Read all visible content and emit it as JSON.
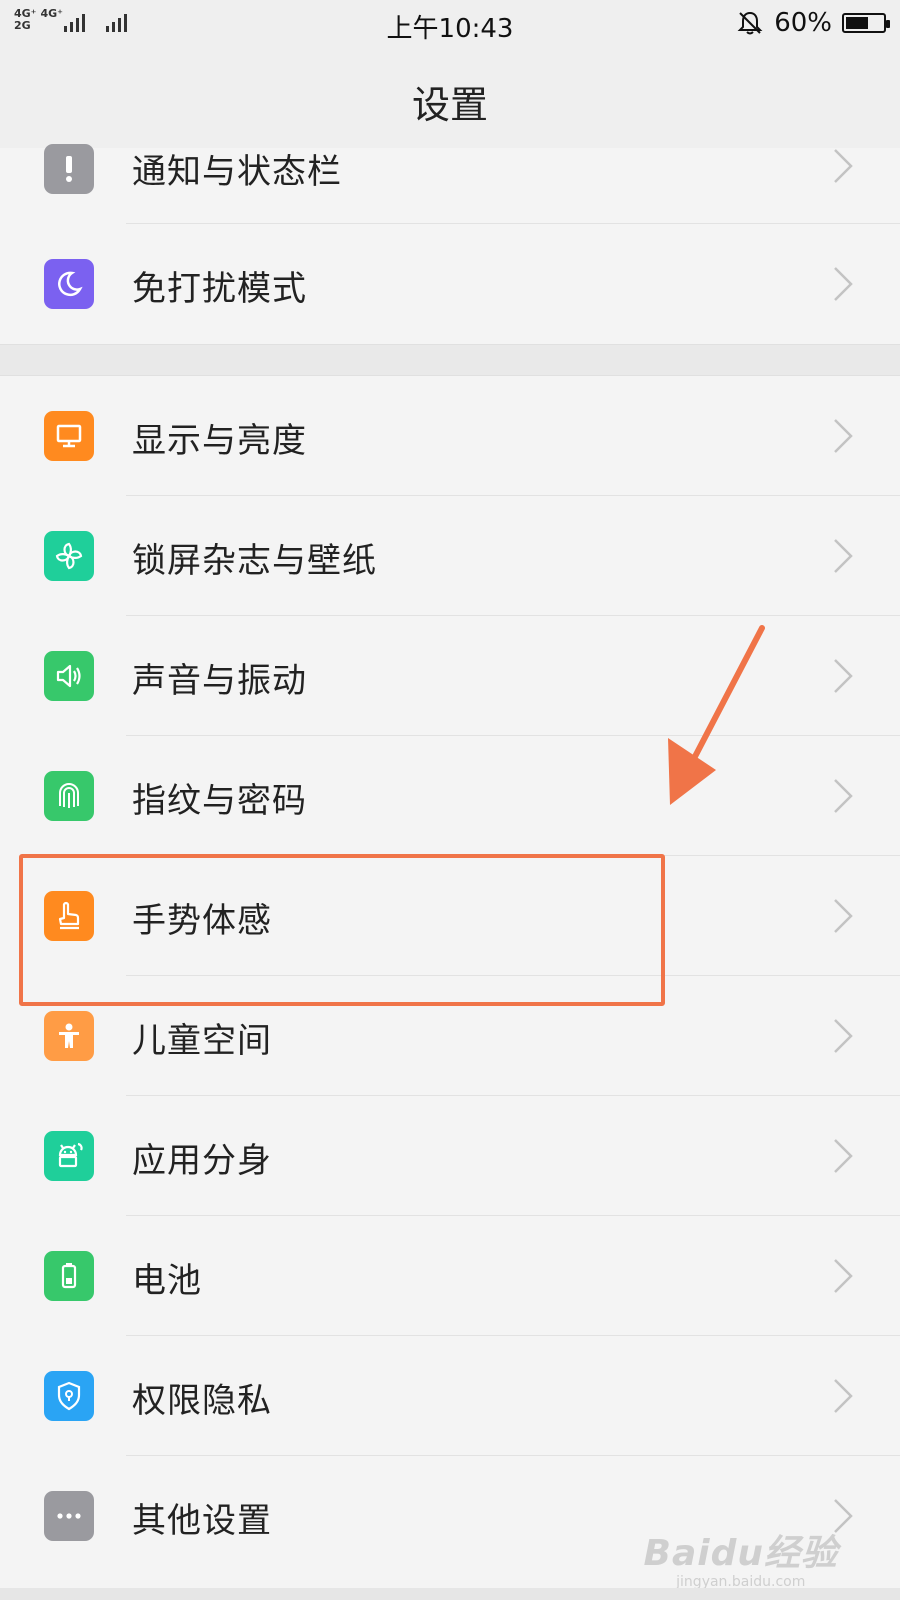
{
  "status_bar": {
    "network_top": [
      "4G⁺",
      "4G⁺"
    ],
    "network_bottom": [
      "2G"
    ],
    "network_label_2g": "2G",
    "time": "上午10:43",
    "battery_percent": "60%",
    "battery_level": 0.6
  },
  "header": {
    "title": "设置"
  },
  "groups": [
    {
      "items": [
        {
          "label": "通知与状态栏",
          "icon": "notification-icon",
          "color": "#9a9a9f"
        },
        {
          "label": "免打扰模式",
          "icon": "moon-icon",
          "color": "#7b61f0"
        }
      ]
    },
    {
      "items": [
        {
          "label": "显示与亮度",
          "icon": "display-icon",
          "color": "#ff8a1f"
        },
        {
          "label": "锁屏杂志与壁纸",
          "icon": "pinwheel-icon",
          "color": "#1fcf9a"
        },
        {
          "label": "声音与振动",
          "icon": "speaker-icon",
          "color": "#37c86b"
        },
        {
          "label": "指纹与密码",
          "icon": "fingerprint-icon",
          "color": "#37c86b"
        },
        {
          "label": "手势体感",
          "icon": "hand-gesture-icon",
          "color": "#ff8a1f"
        },
        {
          "label": "儿童空间",
          "icon": "child-icon",
          "color": "#ff9c45"
        },
        {
          "label": "应用分身",
          "icon": "android-clone-icon",
          "color": "#1fcf9a"
        },
        {
          "label": "电池",
          "icon": "battery-icon",
          "color": "#37c86b"
        },
        {
          "label": "权限隐私",
          "icon": "shield-icon",
          "color": "#2aa4f4"
        },
        {
          "label": "其他设置",
          "icon": "more-icon",
          "color": "#9a9a9f"
        }
      ]
    }
  ],
  "annotation": {
    "highlight_color": "#f07448"
  },
  "watermark": {
    "line1": "Baidu经验",
    "line2": "jingyan.baidu.com"
  }
}
